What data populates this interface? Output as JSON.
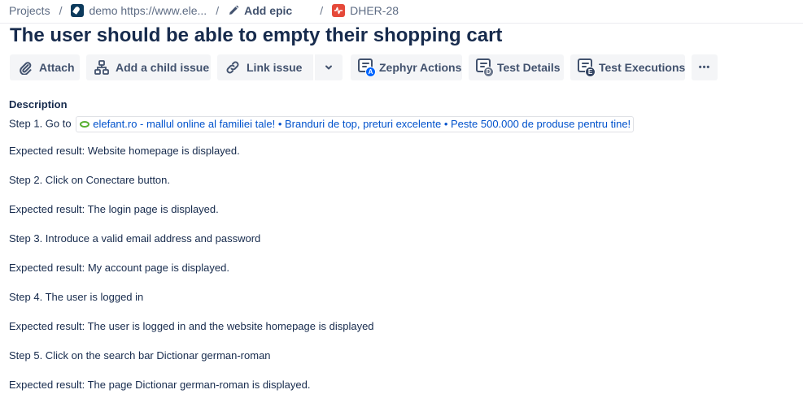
{
  "breadcrumbs": {
    "projects": "Projects",
    "project": "demo https://www.ele...",
    "add_epic": "Add epic",
    "issue_key": "DHER-28",
    "separator": "/"
  },
  "issue": {
    "title": "The user should be able to empty their shopping cart"
  },
  "toolbar": {
    "attach": "Attach",
    "add_child": "Add a child issue",
    "link_issue": "Link issue",
    "zephyr_actions": "Zephyr Actions",
    "zephyr_badge": "A",
    "test_details": "Test Details",
    "test_details_badge": "D",
    "test_executions": "Test Executions",
    "test_executions_badge": "E",
    "more": "•••"
  },
  "description": {
    "label": "Description",
    "step1_prefix": "Step 1. Go to",
    "step1_link": "elefant.ro - mallul online al familiei tale! • Branduri de top, preturi excelente • Peste 500.000 de produse pentru tine!",
    "lines": [
      "Expected result: Website homepage is displayed.",
      " Step 2. Click on Conectare button.",
      "Expected result: The login page is displayed.",
      " Step 3. Introduce a valid email address and password",
      "Expected result: My account page is displayed.",
      " Step 4. The user is logged in",
      "Expected result: The user is logged in and the website homepage is displayed",
      " Step 5. Click on the search bar Dictionar german-roman",
      "Expected result: The page Dictionar german-roman is displayed."
    ]
  },
  "colors": {
    "text": "#172b4d",
    "link": "#0052cc",
    "button_bg": "#f4f5f7",
    "bug_red": "#e5493a",
    "favicon_green": "#58b031"
  }
}
